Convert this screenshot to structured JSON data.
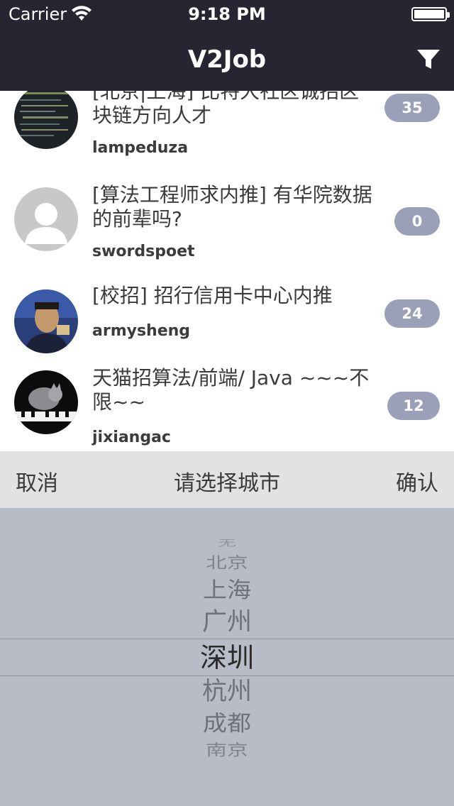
{
  "status_bar": {
    "carrier": "Carrier",
    "time": "9:18 PM"
  },
  "nav": {
    "title": "V2Job",
    "filter_icon": "funnel-icon"
  },
  "posts": [
    {
      "title": "[北京|上海] 比特大社区诚招区块链方向人才",
      "title_visible": "[北京|上海] 比特大社区诚招\n区块链方向人才",
      "author": "lampeduza",
      "replies": "35"
    },
    {
      "title": "[算法工程师求内推] 有华院数据的前辈吗?",
      "author": "swordspoet",
      "replies": "0"
    },
    {
      "title": "[校招] 招行信用卡中心内推",
      "author": "armysheng",
      "replies": "24"
    },
    {
      "title": "天猫招算法/前端/ Java ~~~不限~~",
      "author": "jixiangac",
      "replies": "12"
    }
  ],
  "picker": {
    "cancel_label": "取消",
    "title": "请选择城市",
    "confirm_label": "确认",
    "options": [
      "无",
      "北京",
      "上海",
      "广州",
      "深圳",
      "杭州",
      "成都",
      "南京"
    ],
    "selected": "深圳"
  },
  "colors": {
    "nav_bg": "#252631",
    "badge_bg": "#9aa0b8",
    "picker_bg": "#b7bcc6",
    "toolbar_bg": "#e2e2e2"
  }
}
